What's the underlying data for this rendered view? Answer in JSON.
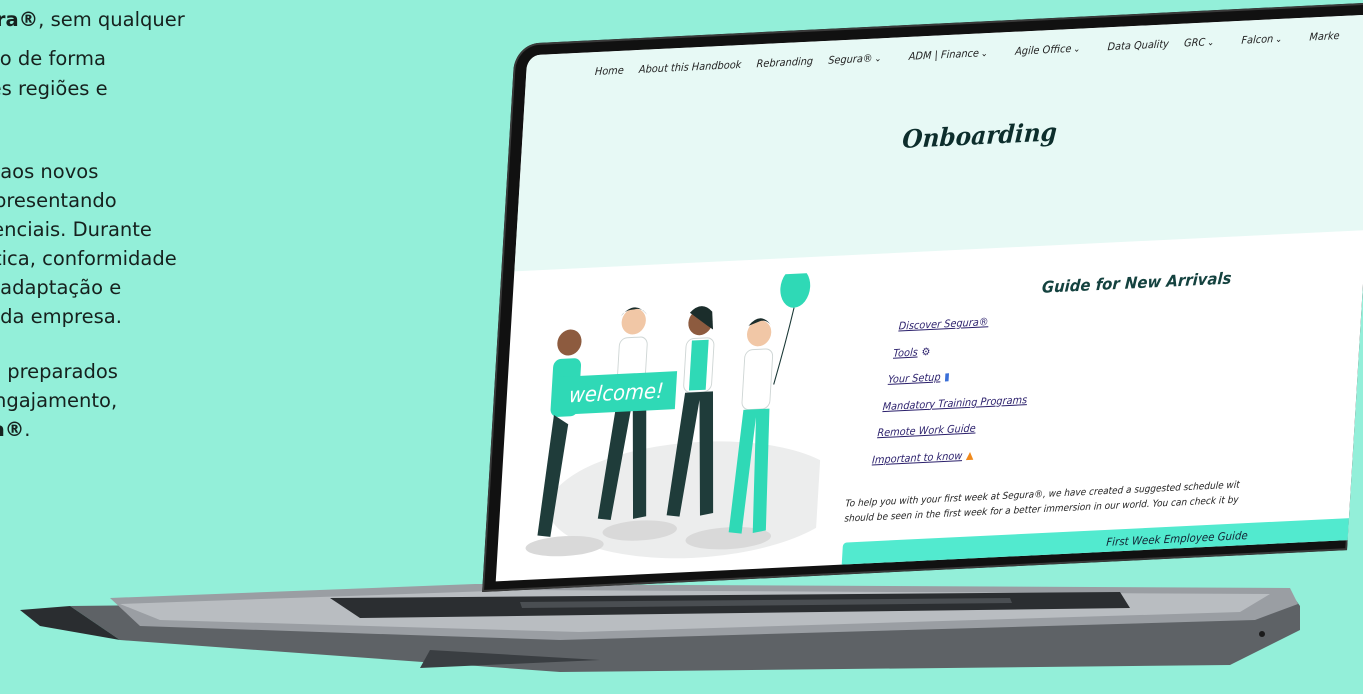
{
  "left_copy": {
    "line1a": "ura®",
    "line1b": ", sem qualquer",
    "line2": "ido de forma",
    "line3": "tes regiões e",
    "line4": "e aos novos",
    "line5": "apresentando",
    "line6": "senciais. Durante",
    "line7": "ética, conformidade",
    "line8": "a adaptação e",
    "line9": "a da empresa.",
    "line10": "m preparados",
    "line11": "engajamento,",
    "line12a": "ra®",
    "line12b": "."
  },
  "nav": {
    "items": [
      {
        "label": "Home",
        "dropdown": false
      },
      {
        "label": "About this Handbook",
        "dropdown": false
      },
      {
        "label": "Rebranding",
        "dropdown": false
      },
      {
        "label": "Segura®",
        "dropdown": true
      },
      {
        "label": "ADM | Finance",
        "dropdown": true
      },
      {
        "label": "Agile Office",
        "dropdown": true
      },
      {
        "label": "Data Quality",
        "dropdown": false
      },
      {
        "label": "GRC",
        "dropdown": true
      },
      {
        "label": "Falcon",
        "dropdown": true
      },
      {
        "label": "Marke",
        "dropdown": false
      }
    ],
    "chevron": "⌄"
  },
  "page": {
    "title": "Onboarding",
    "guide_title": "Guide for New Arrivals",
    "links": [
      {
        "label": "Discover Segura®",
        "icon": ""
      },
      {
        "label": "Tools",
        "icon": "gear-icon"
      },
      {
        "label": "Your Setup",
        "icon": "book-icon"
      },
      {
        "label": "Mandatory Training Programs",
        "icon": ""
      },
      {
        "label": "Remote Work Guide",
        "icon": ""
      },
      {
        "label": "Important to know",
        "icon": "warning-icon"
      }
    ],
    "intro_line1": "To help you with your first week at Segura®, we have created a suggested schedule wit",
    "intro_line2": "should be seen in the first week for a better immersion in our world. You can check it by",
    "cta_label": "First Week Employee Guide",
    "banner_text": "welcome!"
  },
  "colors": {
    "background": "#93efd9",
    "accent": "#52eacf",
    "header_bg": "#e7f9f5",
    "title": "#0d2e2c"
  }
}
